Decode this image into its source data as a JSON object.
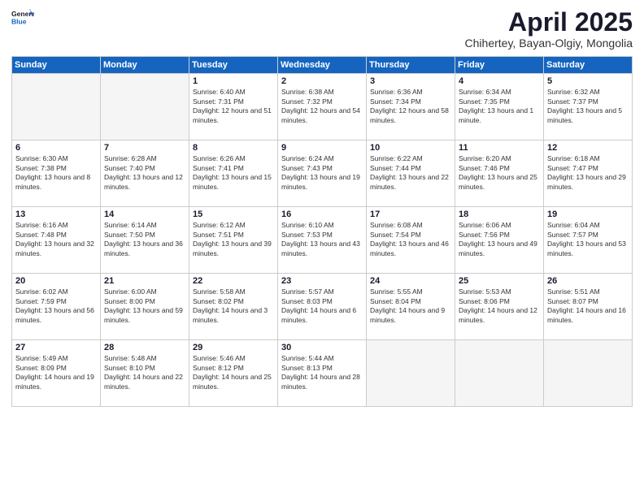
{
  "logo": {
    "general": "General",
    "blue": "Blue"
  },
  "header": {
    "month": "April 2025",
    "location": "Chihertey, Bayan-Olgiy, Mongolia"
  },
  "weekdays": [
    "Sunday",
    "Monday",
    "Tuesday",
    "Wednesday",
    "Thursday",
    "Friday",
    "Saturday"
  ],
  "weeks": [
    [
      {
        "day": "",
        "empty": true
      },
      {
        "day": "",
        "empty": true
      },
      {
        "day": "1",
        "sunrise": "Sunrise: 6:40 AM",
        "sunset": "Sunset: 7:31 PM",
        "daylight": "Daylight: 12 hours and 51 minutes."
      },
      {
        "day": "2",
        "sunrise": "Sunrise: 6:38 AM",
        "sunset": "Sunset: 7:32 PM",
        "daylight": "Daylight: 12 hours and 54 minutes."
      },
      {
        "day": "3",
        "sunrise": "Sunrise: 6:36 AM",
        "sunset": "Sunset: 7:34 PM",
        "daylight": "Daylight: 12 hours and 58 minutes."
      },
      {
        "day": "4",
        "sunrise": "Sunrise: 6:34 AM",
        "sunset": "Sunset: 7:35 PM",
        "daylight": "Daylight: 13 hours and 1 minute."
      },
      {
        "day": "5",
        "sunrise": "Sunrise: 6:32 AM",
        "sunset": "Sunset: 7:37 PM",
        "daylight": "Daylight: 13 hours and 5 minutes."
      }
    ],
    [
      {
        "day": "6",
        "sunrise": "Sunrise: 6:30 AM",
        "sunset": "Sunset: 7:38 PM",
        "daylight": "Daylight: 13 hours and 8 minutes."
      },
      {
        "day": "7",
        "sunrise": "Sunrise: 6:28 AM",
        "sunset": "Sunset: 7:40 PM",
        "daylight": "Daylight: 13 hours and 12 minutes."
      },
      {
        "day": "8",
        "sunrise": "Sunrise: 6:26 AM",
        "sunset": "Sunset: 7:41 PM",
        "daylight": "Daylight: 13 hours and 15 minutes."
      },
      {
        "day": "9",
        "sunrise": "Sunrise: 6:24 AM",
        "sunset": "Sunset: 7:43 PM",
        "daylight": "Daylight: 13 hours and 19 minutes."
      },
      {
        "day": "10",
        "sunrise": "Sunrise: 6:22 AM",
        "sunset": "Sunset: 7:44 PM",
        "daylight": "Daylight: 13 hours and 22 minutes."
      },
      {
        "day": "11",
        "sunrise": "Sunrise: 6:20 AM",
        "sunset": "Sunset: 7:46 PM",
        "daylight": "Daylight: 13 hours and 25 minutes."
      },
      {
        "day": "12",
        "sunrise": "Sunrise: 6:18 AM",
        "sunset": "Sunset: 7:47 PM",
        "daylight": "Daylight: 13 hours and 29 minutes."
      }
    ],
    [
      {
        "day": "13",
        "sunrise": "Sunrise: 6:16 AM",
        "sunset": "Sunset: 7:48 PM",
        "daylight": "Daylight: 13 hours and 32 minutes."
      },
      {
        "day": "14",
        "sunrise": "Sunrise: 6:14 AM",
        "sunset": "Sunset: 7:50 PM",
        "daylight": "Daylight: 13 hours and 36 minutes."
      },
      {
        "day": "15",
        "sunrise": "Sunrise: 6:12 AM",
        "sunset": "Sunset: 7:51 PM",
        "daylight": "Daylight: 13 hours and 39 minutes."
      },
      {
        "day": "16",
        "sunrise": "Sunrise: 6:10 AM",
        "sunset": "Sunset: 7:53 PM",
        "daylight": "Daylight: 13 hours and 43 minutes."
      },
      {
        "day": "17",
        "sunrise": "Sunrise: 6:08 AM",
        "sunset": "Sunset: 7:54 PM",
        "daylight": "Daylight: 13 hours and 46 minutes."
      },
      {
        "day": "18",
        "sunrise": "Sunrise: 6:06 AM",
        "sunset": "Sunset: 7:56 PM",
        "daylight": "Daylight: 13 hours and 49 minutes."
      },
      {
        "day": "19",
        "sunrise": "Sunrise: 6:04 AM",
        "sunset": "Sunset: 7:57 PM",
        "daylight": "Daylight: 13 hours and 53 minutes."
      }
    ],
    [
      {
        "day": "20",
        "sunrise": "Sunrise: 6:02 AM",
        "sunset": "Sunset: 7:59 PM",
        "daylight": "Daylight: 13 hours and 56 minutes."
      },
      {
        "day": "21",
        "sunrise": "Sunrise: 6:00 AM",
        "sunset": "Sunset: 8:00 PM",
        "daylight": "Daylight: 13 hours and 59 minutes."
      },
      {
        "day": "22",
        "sunrise": "Sunrise: 5:58 AM",
        "sunset": "Sunset: 8:02 PM",
        "daylight": "Daylight: 14 hours and 3 minutes."
      },
      {
        "day": "23",
        "sunrise": "Sunrise: 5:57 AM",
        "sunset": "Sunset: 8:03 PM",
        "daylight": "Daylight: 14 hours and 6 minutes."
      },
      {
        "day": "24",
        "sunrise": "Sunrise: 5:55 AM",
        "sunset": "Sunset: 8:04 PM",
        "daylight": "Daylight: 14 hours and 9 minutes."
      },
      {
        "day": "25",
        "sunrise": "Sunrise: 5:53 AM",
        "sunset": "Sunset: 8:06 PM",
        "daylight": "Daylight: 14 hours and 12 minutes."
      },
      {
        "day": "26",
        "sunrise": "Sunrise: 5:51 AM",
        "sunset": "Sunset: 8:07 PM",
        "daylight": "Daylight: 14 hours and 16 minutes."
      }
    ],
    [
      {
        "day": "27",
        "sunrise": "Sunrise: 5:49 AM",
        "sunset": "Sunset: 8:09 PM",
        "daylight": "Daylight: 14 hours and 19 minutes."
      },
      {
        "day": "28",
        "sunrise": "Sunrise: 5:48 AM",
        "sunset": "Sunset: 8:10 PM",
        "daylight": "Daylight: 14 hours and 22 minutes."
      },
      {
        "day": "29",
        "sunrise": "Sunrise: 5:46 AM",
        "sunset": "Sunset: 8:12 PM",
        "daylight": "Daylight: 14 hours and 25 minutes."
      },
      {
        "day": "30",
        "sunrise": "Sunrise: 5:44 AM",
        "sunset": "Sunset: 8:13 PM",
        "daylight": "Daylight: 14 hours and 28 minutes."
      },
      {
        "day": "",
        "empty": true
      },
      {
        "day": "",
        "empty": true
      },
      {
        "day": "",
        "empty": true
      }
    ]
  ]
}
